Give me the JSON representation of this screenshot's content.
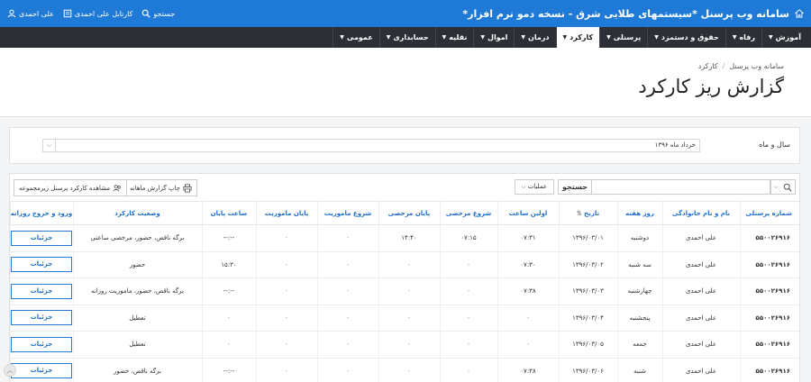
{
  "header": {
    "app_title": "سامانه وب پرسنل *سیستمهای طلایی شرق - نسخه دمو نرم افزار*",
    "links": [
      {
        "label": "جستجو",
        "icon": "search-icon"
      },
      {
        "label": "کارتابل علی احمدی",
        "icon": "inbox-icon"
      },
      {
        "label": "علی احمدی",
        "icon": "user-icon"
      }
    ]
  },
  "nav": {
    "items": [
      {
        "label": "آموزش"
      },
      {
        "label": "رفاه"
      },
      {
        "label": "حقوق و دستمزد"
      },
      {
        "label": "پرسنلی"
      },
      {
        "label": "کارکرد"
      },
      {
        "label": "درمان"
      },
      {
        "label": "اموال"
      },
      {
        "label": "نقلیه"
      },
      {
        "label": "حسابداری"
      },
      {
        "label": "عمومی"
      }
    ],
    "active_index": 4
  },
  "breadcrumb": [
    "سامانه وب پرسنل",
    "کارکرد"
  ],
  "page_title": "گزارش ریز کارکرد",
  "filter": {
    "label": "سال و ماه",
    "value": "خرداد ماه ۱۳۹۶"
  },
  "toolbar": {
    "search_label": "جستجو",
    "operations_label": "عملیات",
    "print_label": "چاپ گزارش ماهانه",
    "subordinates_label": "مشاهده کارکرد پرسنل زیرمجموعه"
  },
  "table": {
    "columns": [
      "شماره پرسنلی",
      "نام و نام خانوادگی",
      "روز هفته",
      "تاریخ",
      "اولین ساعت",
      "شروع مرخصی",
      "پایان مرخصی",
      "شروع ماموریت",
      "پایان ماموریت",
      "ساعت پایان",
      "وضعیت کارکرد",
      "ورود و خروج روزانه"
    ],
    "details_label": "جزئیات",
    "rows": [
      [
        "۵۵۰۰۲۶۹۱۶",
        "علی احمدی",
        "دوشنبه",
        "۱۳۹۶/۰۳/۰۱",
        "۰۷:۳۱",
        "۰۷:۱۵",
        "۱۴:۴۰",
        "-",
        "-",
        "--:--",
        "برگه ناقص، حضور، مرخصی ساعتی"
      ],
      [
        "۵۵۰۰۲۶۹۱۶",
        "علی احمدی",
        "سه شنبه",
        "۱۳۹۶/۰۳/۰۲",
        "۰۷:۳۰",
        "-",
        "-",
        "-",
        "-",
        "۱۵:۳۰",
        "حضور"
      ],
      [
        "۵۵۰۰۲۶۹۱۶",
        "علی احمدی",
        "چهارشنبه",
        "۱۳۹۶/۰۳/۰۳",
        "۰۷:۳۸",
        "-",
        "-",
        "-",
        "-",
        "--:--",
        "برگه ناقص، حضور، ماموریت روزانه"
      ],
      [
        "۵۵۰۰۲۶۹۱۶",
        "علی احمدی",
        "پنجشنبه",
        "۱۳۹۶/۰۳/۰۴",
        "-",
        "-",
        "-",
        "-",
        "-",
        "-",
        "تعطیل"
      ],
      [
        "۵۵۰۰۲۶۹۱۶",
        "علی احمدی",
        "جمعه",
        "۱۳۹۶/۰۳/۰۵",
        "-",
        "-",
        "-",
        "-",
        "-",
        "-",
        "تعطیل"
      ],
      [
        "۵۵۰۰۲۶۹۱۶",
        "علی احمدی",
        "شنبه",
        "۱۳۹۶/۰۳/۰۶",
        "۰۷:۳۸",
        "-",
        "-",
        "-",
        "-",
        "--:--",
        "برگه ناقص، حضور"
      ]
    ]
  },
  "colors": {
    "primary": "#1e7ad6",
    "nav_bg": "#2c2f36",
    "link": "#1e6fcf"
  }
}
